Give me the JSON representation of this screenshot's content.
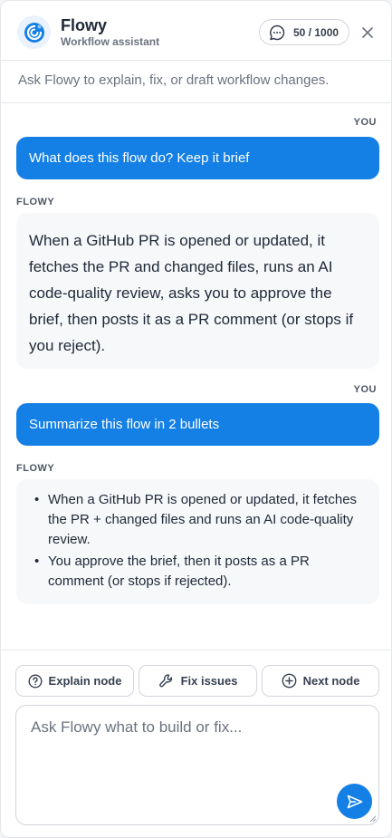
{
  "header": {
    "title": "Flowy",
    "subtitle": "Workflow assistant",
    "quota": "50 / 1000",
    "logo_icon": "flowy-swirl-logo",
    "chat_icon": "message-icon",
    "close_icon": "close-icon"
  },
  "hint": "Ask Flowy to explain, fix, or draft workflow changes.",
  "messages": {
    "m1": {
      "role": "YOU",
      "text": "What does this flow do? Keep it brief"
    },
    "m2": {
      "role": "FLOWY",
      "text": "When a GitHub PR is opened or updated, it fetches the PR and changed files, runs an AI code-quality review, asks you to approve the brief, then posts it as a PR comment (or stops if you reject)."
    },
    "m3": {
      "role": "YOU",
      "text": "Summarize this flow in 2 bullets"
    },
    "m4": {
      "role": "FLOWY",
      "bullets": [
        "When a GitHub PR is opened or updated, it fetches the PR + changed files and runs an AI code-quality review.",
        "You approve the brief, then it posts as a PR comment (or stops if rejected)."
      ]
    }
  },
  "actions": {
    "explain": "Explain node",
    "fix": "Fix issues",
    "next": "Next node"
  },
  "composer": {
    "placeholder": "Ask Flowy what to build or fix..."
  },
  "colors": {
    "accent": "#1480e6",
    "bot_bubble": "#f7f8fa",
    "border": "#e5e7eb"
  }
}
